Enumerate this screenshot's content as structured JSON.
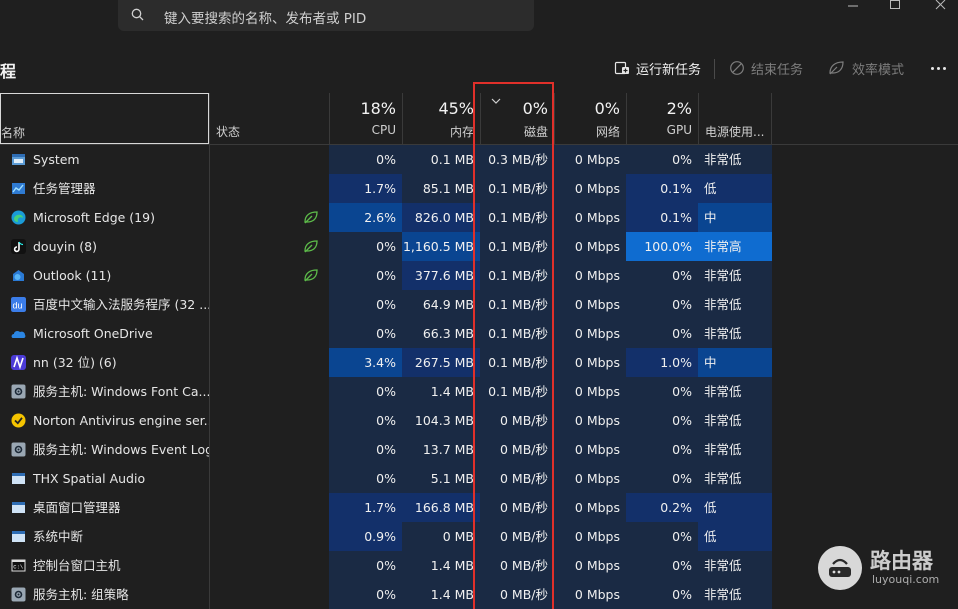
{
  "search": {
    "placeholder": "键入要搜索的名称、发布者或 PID"
  },
  "header": {
    "title": "程",
    "run_new_task": "运行新任务",
    "end_task": "结束任务",
    "efficiency_mode": "效率模式"
  },
  "columns": {
    "name": "名称",
    "status": "状态",
    "cpu": {
      "pct": "18%",
      "label": "CPU"
    },
    "memory": {
      "pct": "45%",
      "label": "内存"
    },
    "disk": {
      "pct": "0%",
      "label": "磁盘"
    },
    "network": {
      "pct": "0%",
      "label": "网络"
    },
    "gpu": {
      "pct": "2%",
      "label": "GPU"
    },
    "power": "电源使用..."
  },
  "colors": {
    "heat0": "#1a2a44",
    "heat1": "#13306a",
    "heat2": "#0a4591",
    "heat3": "#0f6cd0",
    "highlight": "#e0302a",
    "eco_leaf": "#5dbb4a"
  },
  "rows": [
    {
      "name": "System",
      "icon": "system-window-icon",
      "eco": false,
      "cpu": "0%",
      "mem": "0.1 MB",
      "disk": "0.3 MB/秒",
      "net": "0 Mbps",
      "gpu": "0%",
      "power": "非常低"
    },
    {
      "name": "任务管理器",
      "icon": "task-manager-icon",
      "eco": false,
      "cpu": "1.7%",
      "mem": "85.1 MB",
      "disk": "0.1 MB/秒",
      "net": "0 Mbps",
      "gpu": "0.1%",
      "power": "低"
    },
    {
      "name": "Microsoft Edge (19)",
      "icon": "edge-icon",
      "eco": true,
      "cpu": "2.6%",
      "mem": "826.0 MB",
      "disk": "0.1 MB/秒",
      "net": "0 Mbps",
      "gpu": "0.1%",
      "power": "中"
    },
    {
      "name": "douyin (8)",
      "icon": "douyin-icon",
      "eco": true,
      "cpu": "0%",
      "mem": "1,160.5 MB",
      "disk": "0.1 MB/秒",
      "net": "0 Mbps",
      "gpu": "100.0%",
      "power": "非常高"
    },
    {
      "name": "Outlook (11)",
      "icon": "outlook-icon",
      "eco": true,
      "cpu": "0%",
      "mem": "377.6 MB",
      "disk": "0.1 MB/秒",
      "net": "0 Mbps",
      "gpu": "0%",
      "power": "非常低"
    },
    {
      "name": "百度中文输入法服务程序 (32 ...",
      "icon": "baidu-ime-icon",
      "eco": false,
      "cpu": "0%",
      "mem": "64.9 MB",
      "disk": "0.1 MB/秒",
      "net": "0 Mbps",
      "gpu": "0%",
      "power": "非常低"
    },
    {
      "name": "Microsoft OneDrive",
      "icon": "onedrive-icon",
      "eco": false,
      "cpu": "0%",
      "mem": "66.3 MB",
      "disk": "0.1 MB/秒",
      "net": "0 Mbps",
      "gpu": "0%",
      "power": "非常低"
    },
    {
      "name": "nn (32 位) (6)",
      "icon": "nn-icon",
      "eco": false,
      "cpu": "3.4%",
      "mem": "267.5 MB",
      "disk": "0.1 MB/秒",
      "net": "0 Mbps",
      "gpu": "1.0%",
      "power": "中"
    },
    {
      "name": "服务主机: Windows Font Ca...",
      "icon": "service-host-icon",
      "eco": false,
      "cpu": "0%",
      "mem": "1.4 MB",
      "disk": "0.1 MB/秒",
      "net": "0 Mbps",
      "gpu": "0%",
      "power": "非常低"
    },
    {
      "name": "Norton Antivirus engine ser...",
      "icon": "norton-icon",
      "eco": false,
      "cpu": "0%",
      "mem": "104.3 MB",
      "disk": "0 MB/秒",
      "net": "0 Mbps",
      "gpu": "0%",
      "power": "非常低"
    },
    {
      "name": "服务主机: Windows Event Log",
      "icon": "service-host-icon",
      "eco": false,
      "cpu": "0%",
      "mem": "13.7 MB",
      "disk": "0 MB/秒",
      "net": "0 Mbps",
      "gpu": "0%",
      "power": "非常低"
    },
    {
      "name": "THX Spatial Audio",
      "icon": "app-window-icon",
      "eco": false,
      "cpu": "0%",
      "mem": "5.1 MB",
      "disk": "0 MB/秒",
      "net": "0 Mbps",
      "gpu": "0%",
      "power": "非常低"
    },
    {
      "name": "桌面窗口管理器",
      "icon": "app-window-icon",
      "eco": false,
      "cpu": "1.7%",
      "mem": "166.8 MB",
      "disk": "0 MB/秒",
      "net": "0 Mbps",
      "gpu": "0.2%",
      "power": "低"
    },
    {
      "name": "系统中断",
      "icon": "app-window-icon",
      "eco": false,
      "cpu": "0.9%",
      "mem": "0 MB",
      "disk": "0 MB/秒",
      "net": "0 Mbps",
      "gpu": "0%",
      "power": "低"
    },
    {
      "name": "控制台窗口主机",
      "icon": "console-icon",
      "eco": false,
      "cpu": "0%",
      "mem": "1.4 MB",
      "disk": "0 MB/秒",
      "net": "0 Mbps",
      "gpu": "0%",
      "power": "非常低"
    },
    {
      "name": "服务主机: 组策略",
      "icon": "service-host-icon",
      "eco": false,
      "cpu": "0%",
      "mem": "1.4 MB",
      "disk": "0 MB/秒",
      "net": "0 Mbps",
      "gpu": "0%",
      "power": "非常低"
    }
  ],
  "watermark": {
    "name": "路由器",
    "url": "luyouqi.com"
  }
}
